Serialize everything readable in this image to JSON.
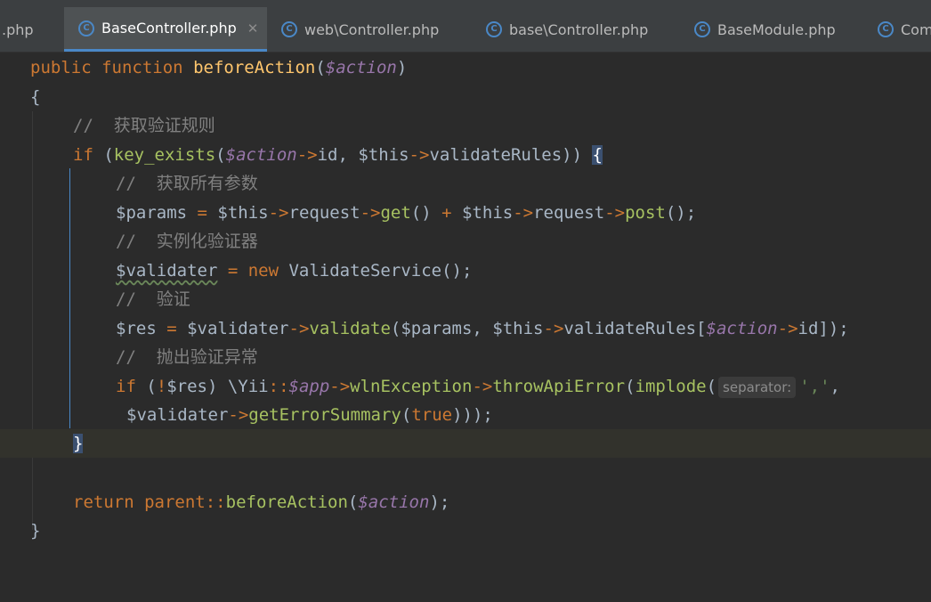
{
  "tabs": [
    {
      "label": ".php",
      "icon": "php-class-icon"
    },
    {
      "label": "BaseController.php",
      "icon": "php-class-icon",
      "active": true
    },
    {
      "label": "web\\Controller.php",
      "icon": "php-class-icon"
    },
    {
      "label": "base\\Controller.php",
      "icon": "php-class-icon"
    },
    {
      "label": "BaseModule.php",
      "icon": "php-class-icon"
    },
    {
      "label": "Com",
      "icon": "php-class-icon"
    }
  ],
  "code": {
    "l1": {
      "kw1": "public",
      "kw2": "function",
      "fn": "beforeAction",
      "p1": "(",
      "var": "$action",
      "p2": ")"
    },
    "l2": {
      "t": "{"
    },
    "l3": {
      "cmt": "//  获取验证规则"
    },
    "l4": {
      "kw": "if",
      "t1": " (",
      "fn": "key_exists",
      "t2": "(",
      "var": "$action",
      "arr": "->",
      "t3": "id, $this",
      "arr2": "->",
      "t4": "validateRules)) ",
      "brace": "{"
    },
    "l5": {
      "cmt": "//  获取所有参数"
    },
    "l6": {
      "t1": "$params ",
      "op": "=",
      "t2": " $this",
      "a1": "->",
      "t3": "request",
      "a2": "->",
      "m1": "get",
      "t4": "() ",
      "op2": "+",
      "t5": " $this",
      "a3": "->",
      "t6": "request",
      "a4": "->",
      "m2": "post",
      "t7": "();"
    },
    "l7": {
      "cmt": "//  实例化验证器"
    },
    "l8": {
      "t1": "$validater",
      "op": " = ",
      "kw": "new",
      "t2": " ValidateService();"
    },
    "l9": {
      "cmt": "//  验证"
    },
    "l10": {
      "t1": "$res ",
      "op": "=",
      "t2": " $validater",
      "a1": "->",
      "m1": "validate",
      "t3": "($params, $this",
      "a2": "->",
      "t4": "validateRules[",
      "var": "$action",
      "a3": "->",
      "t5": "id]);"
    },
    "l11": {
      "cmt": "//  抛出验证异常"
    },
    "l12": {
      "kw": "if",
      "t1": " (",
      "op": "!",
      "t2": "$res) \\Yii",
      "dc": "::",
      "var": "$app",
      "a1": "->",
      "m1": "wlnException",
      "a2": "->",
      "m2": "throwApiError",
      "t3": "(",
      "m3": "implode",
      "t4": "(",
      "hint": "separator:",
      "str": "','",
      "t5": ","
    },
    "l13": {
      "t1": "$validater",
      "a1": "->",
      "m1": "getErrorSummary",
      "t2": "(",
      "kw": "true",
      "t3": ")));"
    },
    "l14": {
      "brace": "}"
    },
    "l16": {
      "kw": "return",
      "kw2": "parent",
      "dc": "::",
      "fn": "beforeAction",
      "t1": "(",
      "var": "$action",
      "t2": ");"
    },
    "l17": {
      "t": "}"
    }
  }
}
